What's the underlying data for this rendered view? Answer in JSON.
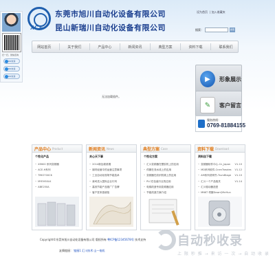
{
  "header": {
    "logo_text": "XCE",
    "company_name_1": "东莞市旭川自动化设备有限公司",
    "company_name_2": "昆山新瑞川自动化设备有限公司",
    "top_links": [
      "设为首页",
      "加入收藏夹"
    ],
    "search_label": "搜索：",
    "search_placeholder": "",
    "search_button": "搜索"
  },
  "nav": [
    "网站首页",
    "关于我们",
    "产品中心",
    "新闻资讯",
    "典型方案",
    "资料下载",
    "联系我们"
  ],
  "sidebar": {
    "caption": "扫一扫，微信咨询",
    "qq": [
      "QQ交谈",
      "QQ交谈",
      "QQ交谈"
    ]
  },
  "main": {
    "no_data": "无法加载插件。"
  },
  "right": {
    "display_label": "形象展示",
    "message_label": "客户留言",
    "phone_label": "服务热线：",
    "phone_number": "0769-81884155"
  },
  "columns": [
    {
      "title": "产品中心",
      "en": "Product",
      "subtitle": "个性化产品",
      "items": [
        {
          "a": "XE600  系列变频器",
          "b": ""
        },
        {
          "a": "ACE-H系列",
          "b": ""
        },
        {
          "a": "TMIO700CK",
          "b": ""
        },
        {
          "a": "MYEH50LK",
          "b": ""
        },
        {
          "a": "ABE250A",
          "b": ""
        }
      ]
    },
    {
      "title": "新闻资讯",
      "en": "News",
      "subtitle": "关心天下事",
      "items": [
        {
          "a": "2014新加坡参展",
          "b": ""
        },
        {
          "a": "钢材经营中的运营注意事项",
          "b": ""
        },
        {
          "a": "工业自动化现场节能技术",
          "b": ""
        },
        {
          "a": "我司进入国际企业行列",
          "b": ""
        },
        {
          "a": "高效节能产品推广广告牌",
          "b": ""
        },
        {
          "a": "客户发来感谢信",
          "b": ""
        }
      ]
    },
    {
      "title": "典型方案",
      "en": "Case",
      "subtitle": "个性化方案",
      "items": [
        {
          "a": "汇川变频器在塑胶机上的应用",
          "b": ""
        },
        {
          "a": "伺服在流水线上的应用",
          "b": ""
        },
        {
          "a": "变频器在纺织机械上的应用",
          "b": ""
        },
        {
          "a": "PLC在包装行业的应用",
          "b": ""
        },
        {
          "a": "电梯改造专用变频器应用",
          "b": ""
        },
        {
          "a": "节能改造方案介绍",
          "b": ""
        }
      ]
    },
    {
      "title": "资料下载",
      "en": "Download",
      "subtitle": "资料自下载",
      "items": [
        {
          "a": "变频器软件中心-Cn_Japan",
          "b": "V1.10"
        },
        {
          "a": "MD系列软件-CnenTrasdes",
          "b": "V1.12"
        },
        {
          "a": "AM系列说明书-TrumBlage",
          "b": "V1.10"
        },
        {
          "a": "汇川一个产品相关",
          "b": "V1.14"
        },
        {
          "a": "汇川驱动器选型",
          "b": ""
        },
        {
          "a": "MNKT 伺服DownQfhrHun",
          "b": ""
        }
      ]
    }
  ],
  "footer": {
    "copyright_prefix": "Copyright©东莞市旭川自动化设备有限公司 版权所有  ",
    "icp": "粤ICP备12345678号",
    "stats": " 技术支持",
    "links_label": "友情链接：",
    "links": [
      "链接1",
      "汇川技术",
      "山一电机"
    ]
  },
  "watermark": {
    "big": "自动秒收录",
    "small": "上 限 秒 推 → 来 访 一 次 → 自 动 收 录"
  },
  "colors": {
    "nav_text": "#555555",
    "column_title": "#e07b1a",
    "company_name": "#1b3f8f",
    "accent": "#1f5fae"
  }
}
